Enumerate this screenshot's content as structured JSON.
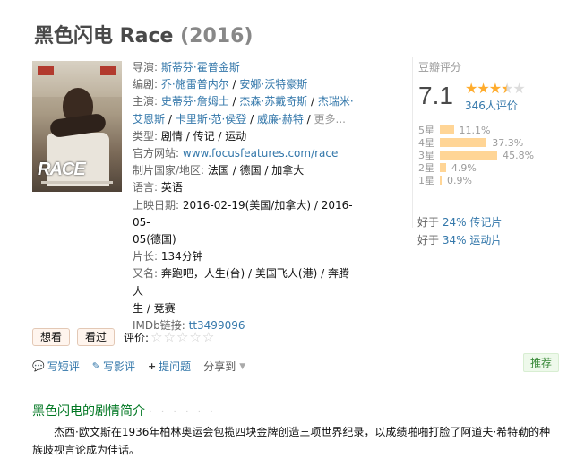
{
  "title": {
    "name": "黑色闪电 Race",
    "year": "(2016)"
  },
  "poster": {
    "logo_text": "RACE"
  },
  "info": {
    "director_label": "导演:",
    "director": "斯蒂芬·霍普金斯",
    "writer_label": "编剧:",
    "writers": [
      "乔·施雷普内尔",
      "安娜·沃特豪斯"
    ],
    "cast_label": "主演:",
    "cast": [
      "史蒂芬·詹姆士",
      "杰森·苏戴奇斯",
      "杰瑞米·艾恩斯",
      "卡里斯·范·侯登",
      "威廉·赫特"
    ],
    "cast_more": "更多...",
    "genre_label": "类型:",
    "genres": [
      "剧情",
      "传记",
      "运动"
    ],
    "website_label": "官方网站:",
    "website": "www.focusfeatures.com/race",
    "country_label": "制片国家/地区:",
    "country": "法国 / 德国 / 加拿大",
    "language_label": "语言:",
    "language": "英语",
    "release_label": "上映日期:",
    "release_1": "2016-02-19(美国/加拿大)",
    "release_2a": "2016-05-",
    "release_2b": "05(德国)",
    "runtime_label": "片长:",
    "runtime": "134分钟",
    "aka_label": "又名:",
    "aka_line1": "奔跑吧，人生(台) / 美国飞人(港) / 奔腾人",
    "aka_line2": "生 / 竞赛",
    "imdb_label": "IMDb链接:",
    "imdb": "tt3499096"
  },
  "rating": {
    "label": "豆瓣评分",
    "score": "7.1",
    "stars_full": "★★★",
    "stars_half": "★",
    "stars_empty": "★",
    "votes": "346人评价",
    "distribution": [
      {
        "name": "5星",
        "pct": "11.1%",
        "value": 11.1
      },
      {
        "name": "4星",
        "pct": "37.3%",
        "value": 37.3
      },
      {
        "name": "3星",
        "pct": "45.8%",
        "value": 45.8
      },
      {
        "name": "2星",
        "pct": "4.9%",
        "value": 4.9
      },
      {
        "name": "1星",
        "pct": "0.9%",
        "value": 0.9
      }
    ]
  },
  "better_than": [
    {
      "prefix": "好于 ",
      "pct": "24%",
      "cat": "传记片"
    },
    {
      "prefix": "好于 ",
      "pct": "34%",
      "cat": "运动片"
    }
  ],
  "actions": {
    "want": "想看",
    "seen": "看过",
    "rate_label": "评价:",
    "rate_stars": "☆☆☆☆☆"
  },
  "links": {
    "short_review": "写短评",
    "review": "写影评",
    "ask": "提问题",
    "share": "分享到"
  },
  "recommend": "推荐",
  "summary": {
    "title": "黑色闪电的剧情简介",
    "dots": "· · · · · ·",
    "text": "杰西·欧文斯在1936年柏林奥运会包揽四块金牌创造三项世界纪录，以成绩啪啪打脸了阿道夫·希特勒的种族歧视言论成为佳话。"
  },
  "colors": {
    "link": "#3377aa",
    "bar": "#ffd596",
    "star": "#ffac2d",
    "section_title": "#007722"
  }
}
